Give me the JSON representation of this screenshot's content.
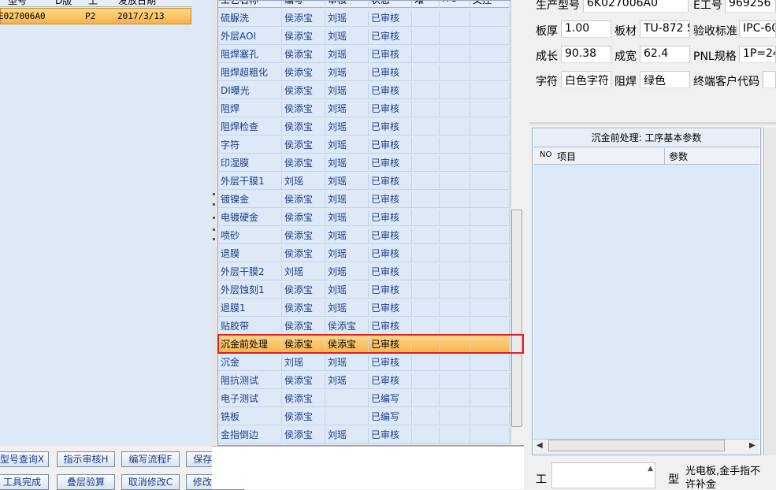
{
  "left_table": {
    "headers": [
      "型号",
      "D版",
      "工",
      "发放日期"
    ],
    "row": {
      "model": "E027006A0",
      "rev": "P2",
      "date": "2017/3/13"
    }
  },
  "process_table": {
    "headers": [
      "工艺名称",
      "编写",
      "审核",
      "状态",
      "难",
      "ITC",
      "文控"
    ],
    "rows": [
      {
        "name": "硫脲洗",
        "writer": "侯添宝",
        "reviewer": "刘瑶",
        "status": "已审核"
      },
      {
        "name": "外层AOI",
        "writer": "侯添宝",
        "reviewer": "刘瑶",
        "status": "已审核"
      },
      {
        "name": "阻焊塞孔",
        "writer": "侯添宝",
        "reviewer": "刘瑶",
        "status": "已审核"
      },
      {
        "name": "阻焊超粗化",
        "writer": "侯添宝",
        "reviewer": "刘瑶",
        "status": "已审核"
      },
      {
        "name": "DI曝光",
        "writer": "侯添宝",
        "reviewer": "刘瑶",
        "status": "已审核"
      },
      {
        "name": "阻焊",
        "writer": "侯添宝",
        "reviewer": "刘瑶",
        "status": "已审核"
      },
      {
        "name": "阻焊检查",
        "writer": "侯添宝",
        "reviewer": "刘瑶",
        "status": "已审核"
      },
      {
        "name": "字符",
        "writer": "侯添宝",
        "reviewer": "刘瑶",
        "status": "已审核"
      },
      {
        "name": "印湿膜",
        "writer": "侯添宝",
        "reviewer": "刘瑶",
        "status": "已审核"
      },
      {
        "name": "外层干膜1",
        "writer": "刘瑶",
        "reviewer": "刘瑶",
        "status": "已审核"
      },
      {
        "name": "镀镍金",
        "writer": "侯添宝",
        "reviewer": "刘瑶",
        "status": "已审核"
      },
      {
        "name": "电镀硬金",
        "writer": "侯添宝",
        "reviewer": "刘瑶",
        "status": "已审核"
      },
      {
        "name": "喷砂",
        "writer": "侯添宝",
        "reviewer": "刘瑶",
        "status": "已审核"
      },
      {
        "name": "退膜",
        "writer": "侯添宝",
        "reviewer": "刘瑶",
        "status": "已审核"
      },
      {
        "name": "外层干膜2",
        "writer": "刘瑶",
        "reviewer": "刘瑶",
        "status": "已审核"
      },
      {
        "name": "外层蚀刻1",
        "writer": "侯添宝",
        "reviewer": "刘瑶",
        "status": "已审核"
      },
      {
        "name": "退膜1",
        "writer": "侯添宝",
        "reviewer": "刘瑶",
        "status": "已审核"
      },
      {
        "name": "贴胶带",
        "writer": "侯添宝",
        "reviewer": "侯添宝",
        "status": "已审核"
      },
      {
        "name": "沉金前处理",
        "writer": "侯添宝",
        "reviewer": "侯添宝",
        "status": "已审核"
      },
      {
        "name": "沉金",
        "writer": "刘瑶",
        "reviewer": "刘瑶",
        "status": "已审核"
      },
      {
        "name": "阻抗测试",
        "writer": "侯添宝",
        "reviewer": "刘瑶",
        "status": "已审核"
      },
      {
        "name": "电子测试",
        "writer": "侯添宝",
        "reviewer": "",
        "status": "已编写"
      },
      {
        "name": "铣板",
        "writer": "侯添宝",
        "reviewer": "",
        "status": "已编写"
      },
      {
        "name": "金指倒边",
        "writer": "侯添宝",
        "reviewer": "刘瑶",
        "status": "已审核"
      }
    ]
  },
  "info": {
    "production_model_label": "生产型号",
    "production_model": "6K027006A0",
    "e_number_label": "E工号",
    "e_number": "969256",
    "thickness_label": "板厚",
    "thickness": "1.00",
    "material_label": "板材",
    "material": "TU-872 S",
    "standard_label": "验收标准",
    "standard": "IPC-60",
    "length_label": "成长",
    "length": "90.38",
    "width_label": "成宽",
    "width": "62.4",
    "pnl_label": "PNL规格",
    "pnl": "1P=24",
    "char_label": "字符",
    "char": "白色字符",
    "mask_label": "阻焊",
    "mask": "绿色",
    "customer_label": "终端客户代码",
    "customer": ""
  },
  "param_panel": {
    "title": "沉金前处理: 工序基本参数",
    "col_no": "NO",
    "col_item": "项目",
    "col_param": "参数"
  },
  "buttons": {
    "model_query": "型号查询X",
    "show_review": "指示审核H",
    "edit_flow": "编写流程F",
    "save_info": "保存信息S",
    "tool_done": "工具完成",
    "stack_check": "叠层验算",
    "cancel_edit": "取消修改C",
    "modify_info": "修改信息R"
  },
  "bottom_right": {
    "label_a": "工",
    "label_b": "型",
    "note": "光电板,金手指不\n许补金"
  },
  "colors": {
    "selected": "#f4b650",
    "highlight_border": "#e02020",
    "grid_bg": "#dde9f7",
    "text_blue": "#1c3c90"
  }
}
